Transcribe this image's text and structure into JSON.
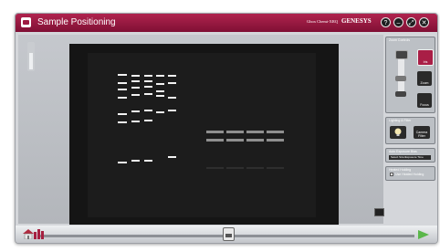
{
  "window": {
    "title": "Sample Positioning",
    "product": "Gbox Chemi-XRQ",
    "brand": "GENESYS",
    "controls": [
      "?",
      "–",
      "⤢",
      "✕"
    ]
  },
  "sidebar": {
    "zoom_focus": {
      "title": "Zoom Controls",
      "buttons": [
        "Iris",
        "Zoom",
        "Focus"
      ]
    },
    "lighting": {
      "title": "Lighting & Filter",
      "camera_filter_label": "Camera Filter"
    },
    "sample_size": {
      "title": "Auto Exposure Bias",
      "value": "Select Size/Exposure Time"
    },
    "heated": {
      "title": "Heated Holding",
      "checkbox_label": "Use Heated Holding"
    }
  },
  "colors": {
    "accent": "#9e1b42",
    "next_arrow": "#5ab74a"
  },
  "bottom": {
    "icons": [
      "home-icon",
      "chart-icon",
      "camera-icon",
      "next-arrow-icon"
    ]
  }
}
